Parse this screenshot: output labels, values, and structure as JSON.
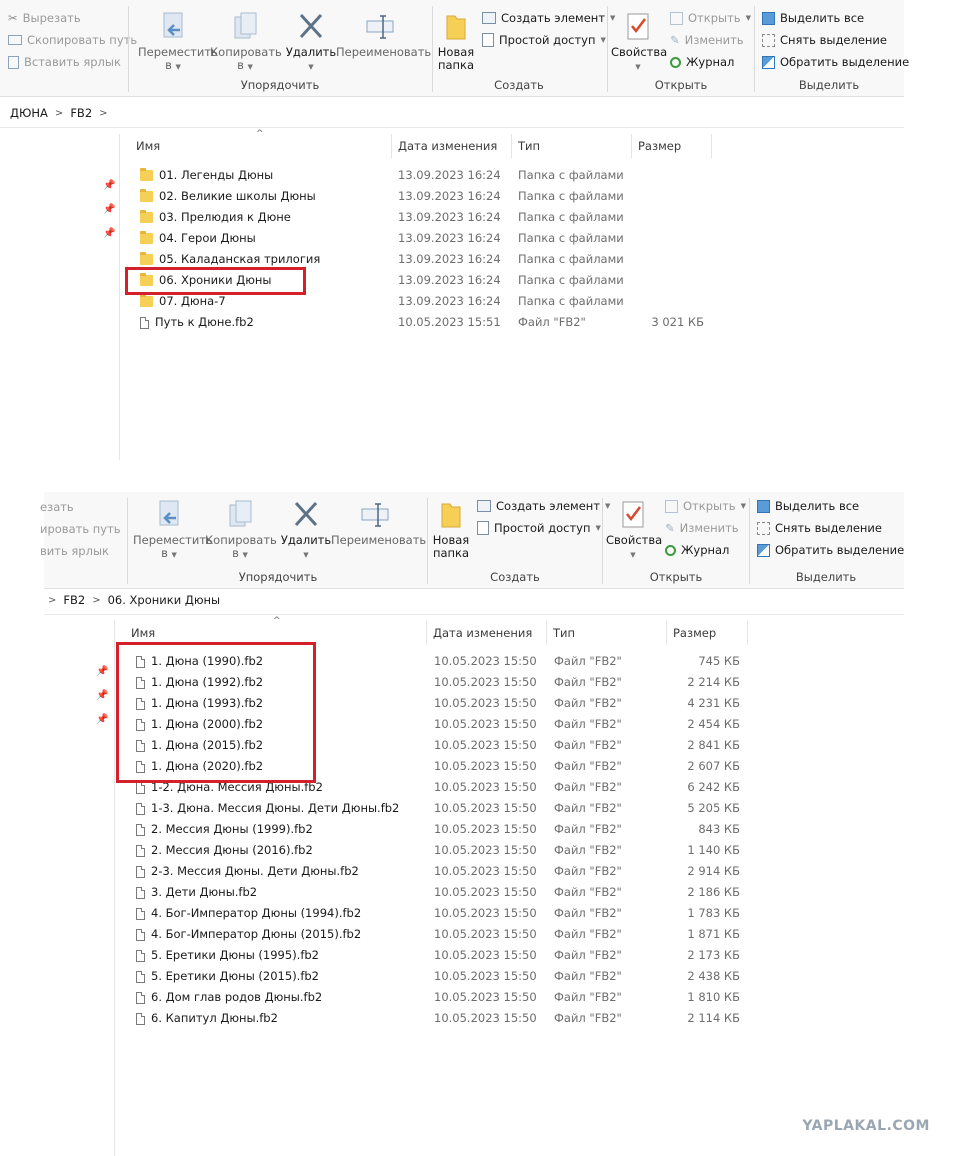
{
  "ribbon": {
    "clipboard": {
      "cut": "Вырезать",
      "copy_path": "Скопировать путь",
      "paste_shortcut": "Вставить ярлык"
    },
    "organize": {
      "move_to": "Переместить",
      "copy_to": "Копировать",
      "delete": "Удалить",
      "rename": "Переименовать",
      "label": "Упорядочить",
      "v": "в"
    },
    "new": {
      "new_folder_1": "Новая",
      "new_folder_2": "папка",
      "new_item": "Создать элемент",
      "easy_access": "Простой доступ",
      "label": "Создать"
    },
    "open": {
      "properties": "Свойства",
      "open": "Открыть",
      "edit": "Изменить",
      "history": "Журнал",
      "label": "Открыть"
    },
    "select": {
      "select_all": "Выделить все",
      "select_none": "Снять выделение",
      "invert": "Обратить выделение",
      "label": "Выделить"
    },
    "clipboard_partial": {
      "cut": "езать",
      "copy_path": "ировать путь",
      "paste_shortcut": "вить ярлык"
    }
  },
  "top": {
    "breadcrumb": [
      "ДЮНА",
      "FB2"
    ],
    "columns": {
      "name": "Имя",
      "date": "Дата изменения",
      "type": "Тип",
      "size": "Размер"
    },
    "rows": [
      {
        "kind": "folder",
        "name": "01. Легенды Дюны",
        "date": "13.09.2023 16:24",
        "type": "Папка с файлами",
        "size": ""
      },
      {
        "kind": "folder",
        "name": "02. Великие школы Дюны",
        "date": "13.09.2023 16:24",
        "type": "Папка с файлами",
        "size": ""
      },
      {
        "kind": "folder",
        "name": "03. Прелюдия к Дюне",
        "date": "13.09.2023 16:24",
        "type": "Папка с файлами",
        "size": ""
      },
      {
        "kind": "folder",
        "name": "04. Герои Дюны",
        "date": "13.09.2023 16:24",
        "type": "Папка с файлами",
        "size": ""
      },
      {
        "kind": "folder",
        "name": "05. Каладанская трилогия",
        "date": "13.09.2023 16:24",
        "type": "Папка с файлами",
        "size": ""
      },
      {
        "kind": "folder",
        "name": "06. Хроники Дюны",
        "date": "13.09.2023 16:24",
        "type": "Папка с файлами",
        "size": ""
      },
      {
        "kind": "folder",
        "name": "07. Дюна-7",
        "date": "13.09.2023 16:24",
        "type": "Папка с файлами",
        "size": ""
      },
      {
        "kind": "file",
        "name": "Путь к Дюне.fb2",
        "date": "10.05.2023 15:51",
        "type": "Файл \"FB2\"",
        "size": "3 021 КБ"
      }
    ]
  },
  "bottom": {
    "breadcrumb": [
      "FB2",
      "06. Хроники Дюны"
    ],
    "columns": {
      "name": "Имя",
      "date": "Дата изменения",
      "type": "Тип",
      "size": "Размер"
    },
    "rows": [
      {
        "kind": "file",
        "name": "1. Дюна (1990).fb2",
        "date": "10.05.2023 15:50",
        "type": "Файл \"FB2\"",
        "size": "745 КБ"
      },
      {
        "kind": "file",
        "name": "1. Дюна (1992).fb2",
        "date": "10.05.2023 15:50",
        "type": "Файл \"FB2\"",
        "size": "2 214 КБ"
      },
      {
        "kind": "file",
        "name": "1. Дюна (1993).fb2",
        "date": "10.05.2023 15:50",
        "type": "Файл \"FB2\"",
        "size": "4 231 КБ"
      },
      {
        "kind": "file",
        "name": "1. Дюна (2000).fb2",
        "date": "10.05.2023 15:50",
        "type": "Файл \"FB2\"",
        "size": "2 454 КБ"
      },
      {
        "kind": "file",
        "name": "1. Дюна (2015).fb2",
        "date": "10.05.2023 15:50",
        "type": "Файл \"FB2\"",
        "size": "2 841 КБ"
      },
      {
        "kind": "file",
        "name": "1. Дюна (2020).fb2",
        "date": "10.05.2023 15:50",
        "type": "Файл \"FB2\"",
        "size": "2 607 КБ"
      },
      {
        "kind": "file",
        "name": "1-2. Дюна. Мессия Дюны.fb2",
        "date": "10.05.2023 15:50",
        "type": "Файл \"FB2\"",
        "size": "6 242 КБ"
      },
      {
        "kind": "file",
        "name": "1-3. Дюна. Мессия Дюны. Дети Дюны.fb2",
        "date": "10.05.2023 15:50",
        "type": "Файл \"FB2\"",
        "size": "5 205 КБ"
      },
      {
        "kind": "file",
        "name": "2. Мессия Дюны (1999).fb2",
        "date": "10.05.2023 15:50",
        "type": "Файл \"FB2\"",
        "size": "843 КБ"
      },
      {
        "kind": "file",
        "name": "2. Мессия Дюны (2016).fb2",
        "date": "10.05.2023 15:50",
        "type": "Файл \"FB2\"",
        "size": "1 140 КБ"
      },
      {
        "kind": "file",
        "name": "2-3. Мессия Дюны. Дети Дюны.fb2",
        "date": "10.05.2023 15:50",
        "type": "Файл \"FB2\"",
        "size": "2 914 КБ"
      },
      {
        "kind": "file",
        "name": "3. Дети Дюны.fb2",
        "date": "10.05.2023 15:50",
        "type": "Файл \"FB2\"",
        "size": "2 186 КБ"
      },
      {
        "kind": "file",
        "name": "4. Бог-Император Дюны (1994).fb2",
        "date": "10.05.2023 15:50",
        "type": "Файл \"FB2\"",
        "size": "1 783 КБ"
      },
      {
        "kind": "file",
        "name": "4. Бог-Император Дюны (2015).fb2",
        "date": "10.05.2023 15:50",
        "type": "Файл \"FB2\"",
        "size": "1 871 КБ"
      },
      {
        "kind": "file",
        "name": "5. Еретики Дюны (1995).fb2",
        "date": "10.05.2023 15:50",
        "type": "Файл \"FB2\"",
        "size": "2 173 КБ"
      },
      {
        "kind": "file",
        "name": "5. Еретики Дюны (2015).fb2",
        "date": "10.05.2023 15:50",
        "type": "Файл \"FB2\"",
        "size": "2 438 КБ"
      },
      {
        "kind": "file",
        "name": "6. Дом глав родов Дюны.fb2",
        "date": "10.05.2023 15:50",
        "type": "Файл \"FB2\"",
        "size": "1 810 КБ"
      },
      {
        "kind": "file",
        "name": "6. Капитул Дюны.fb2",
        "date": "10.05.2023 15:50",
        "type": "Файл \"FB2\"",
        "size": "2 114 КБ"
      }
    ]
  },
  "watermark": "YAPLAKAL.COM",
  "colors": {
    "highlight": "#d4202a",
    "folder": "#f6cf57",
    "accent": "#1f6fc2"
  }
}
